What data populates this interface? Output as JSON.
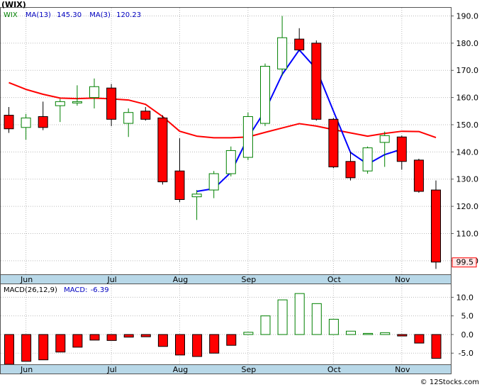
{
  "title": "(WIX)",
  "footer": "© 12Stocks.com",
  "colors": {
    "up": "#ffffff",
    "up_stroke": "#008000",
    "down": "#ff0000",
    "ma13": "#ff0000",
    "ma3": "#0000ff",
    "macd_pos": "#ffffff",
    "macd_neg": "#ff0000",
    "axis_band": "#b8d8e8",
    "grid": "#bbbbbb"
  },
  "chart_data": [
    {
      "type": "candlestick",
      "legend": {
        "symbol": "WIX",
        "ma13_label": "MA(13)",
        "ma13_value": "145.30",
        "ma3_label": "MA(3)",
        "ma3_value": "120.23"
      },
      "x_labels": [
        {
          "label": "Jun",
          "index": 1
        },
        {
          "label": "Jul",
          "index": 6
        },
        {
          "label": "Aug",
          "index": 10
        },
        {
          "label": "Sep",
          "index": 14
        },
        {
          "label": "Oct",
          "index": 19
        },
        {
          "label": "Nov",
          "index": 23
        }
      ],
      "ylim": [
        95,
        193
      ],
      "yticks": [
        "190.0",
        "180.0",
        "170.0",
        "160.0",
        "150.0",
        "140.0",
        "130.0",
        "120.0",
        "110.0",
        "100.0"
      ],
      "last_price": "99.5",
      "candles": [
        {
          "o": 153.5,
          "h": 156.5,
          "l": 147,
          "c": 148.5
        },
        {
          "o": 149,
          "h": 154,
          "l": 144.5,
          "c": 152.5
        },
        {
          "o": 153,
          "h": 158.5,
          "l": 148,
          "c": 149
        },
        {
          "o": 157,
          "h": 159.5,
          "l": 151,
          "c": 158.5
        },
        {
          "o": 158,
          "h": 164.5,
          "l": 157,
          "c": 158.5
        },
        {
          "o": 160,
          "h": 167,
          "l": 156,
          "c": 164
        },
        {
          "o": 163.5,
          "h": 165,
          "l": 149.5,
          "c": 152
        },
        {
          "o": 150.5,
          "h": 156,
          "l": 145.5,
          "c": 154.5
        },
        {
          "o": 155,
          "h": 156.5,
          "l": 151.5,
          "c": 152
        },
        {
          "o": 152.5,
          "h": 153.5,
          "l": 128,
          "c": 129
        },
        {
          "o": 133,
          "h": 145,
          "l": 121.5,
          "c": 122.5
        },
        {
          "o": 123.5,
          "h": 126,
          "l": 115,
          "c": 124.5
        },
        {
          "o": 126,
          "h": 133,
          "l": 123,
          "c": 132
        },
        {
          "o": 132,
          "h": 142,
          "l": 131,
          "c": 140.5
        },
        {
          "o": 138,
          "h": 154.5,
          "l": 137,
          "c": 153
        },
        {
          "o": 150.5,
          "h": 172.5,
          "l": 149.5,
          "c": 171.5
        },
        {
          "o": 170.5,
          "h": 190,
          "l": 168,
          "c": 182
        },
        {
          "o": 181.5,
          "h": 185.5,
          "l": 177,
          "c": 177.5
        },
        {
          "o": 180,
          "h": 181,
          "l": 151.5,
          "c": 152
        },
        {
          "o": 152,
          "h": 152.5,
          "l": 134,
          "c": 134.5
        },
        {
          "o": 136.5,
          "h": 140,
          "l": 129.5,
          "c": 130.5
        },
        {
          "o": 133,
          "h": 142,
          "l": 132,
          "c": 141.5
        },
        {
          "o": 143.5,
          "h": 147.5,
          "l": 134.5,
          "c": 146
        },
        {
          "o": 145.5,
          "h": 146,
          "l": 133.5,
          "c": 136.5
        },
        {
          "o": 137,
          "h": 137.5,
          "l": 125,
          "c": 125.5
        },
        {
          "o": 126,
          "h": 129.5,
          "l": 97,
          "c": 99.5
        }
      ],
      "ma13": [
        165.5,
        163,
        161.2,
        159.8,
        159.6,
        159.8,
        159.5,
        159.1,
        157.5,
        153,
        147.6,
        145.8,
        145.2,
        145.2,
        145.5,
        147.2,
        148.8,
        150.4,
        149.5,
        148.2,
        147,
        145.8,
        146.8,
        147.6,
        147.5,
        145.3
      ],
      "ma3": [
        null,
        null,
        null,
        null,
        null,
        null,
        null,
        null,
        null,
        null,
        null,
        125.5,
        126.5,
        132.5,
        145.3,
        155.2,
        168.5,
        177.5,
        170.5,
        155,
        139.8,
        135.5,
        139,
        141,
        null,
        null
      ]
    },
    {
      "type": "bar",
      "title": "MACD(26,12,9)",
      "value_label": "MACD:",
      "value": "-6.39",
      "ylim": [
        -8,
        13.5
      ],
      "yticks": [
        "10.0",
        "5.0",
        "0.0",
        "-5.0"
      ],
      "values": [
        -8,
        -7.2,
        -6.8,
        -4.7,
        -3.4,
        -1.5,
        -1.6,
        -0.7,
        -0.6,
        -3.2,
        -5.5,
        -5.9,
        -5,
        -2.9,
        0.6,
        5,
        9.3,
        11,
        8.3,
        4.1,
        0.9,
        0.3,
        0.5,
        -0.4,
        -2.3,
        -6.4
      ]
    }
  ]
}
